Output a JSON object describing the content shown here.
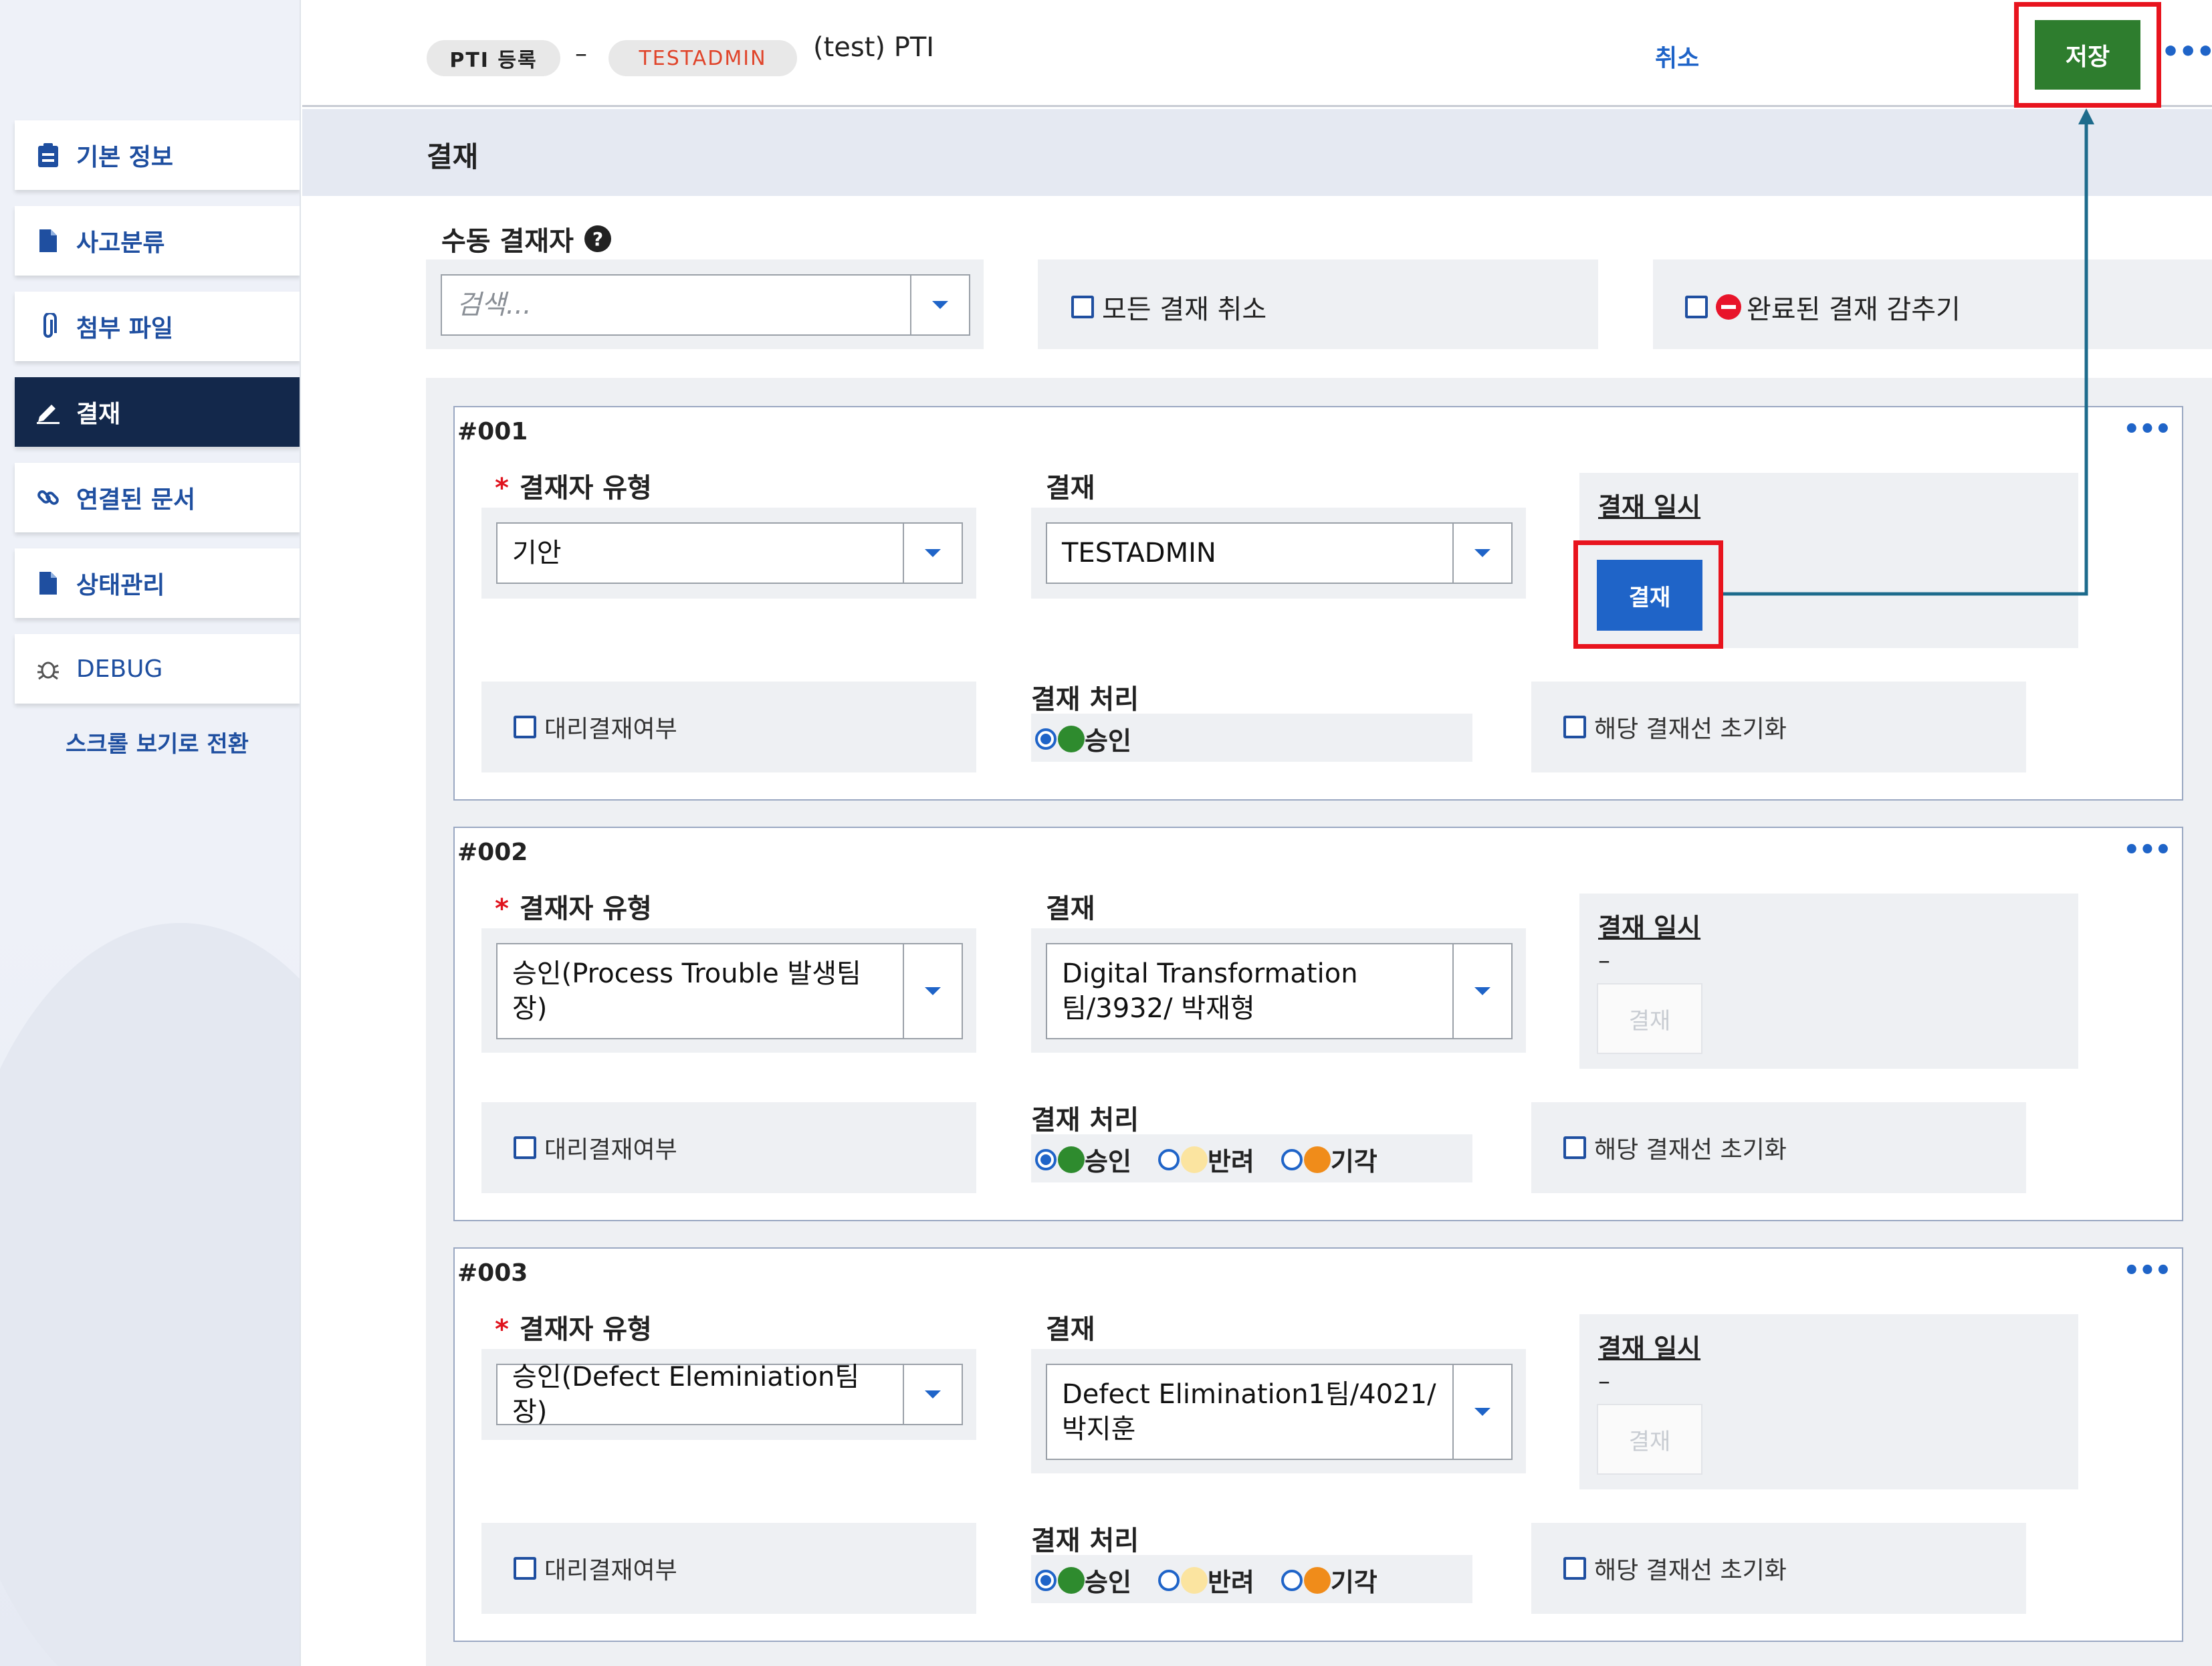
{
  "sidebar": {
    "items": [
      {
        "label": "기본 정보",
        "icon": "clipboard-icon"
      },
      {
        "label": "사고분류",
        "icon": "document-icon"
      },
      {
        "label": "첨부 파일",
        "icon": "paperclip-icon"
      },
      {
        "label": "결재",
        "icon": "pen-icon"
      },
      {
        "label": "연결된 문서",
        "icon": "link-icon"
      },
      {
        "label": "상태관리",
        "icon": "document-icon"
      },
      {
        "label": "DEBUG",
        "icon": "bug-icon"
      }
    ],
    "scroll_link": "스크롤 보기로 전환"
  },
  "header": {
    "tag_pti": "PTI 등록",
    "dash": "–",
    "tag_user": "TESTADMIN",
    "title": "(test) PTI",
    "cancel_label": "취소",
    "save_label": "저장",
    "more_label": "•••"
  },
  "section": {
    "title": "결재"
  },
  "manual": {
    "label": "수동 결재자",
    "search_placeholder": "검색...",
    "cancel_all": "모든 결재 취소",
    "hide_done": "완료된 결재 감추기"
  },
  "labels": {
    "approver_type": "결재자 유형",
    "approver": "결재",
    "approval_datetime": "결재 일시",
    "proxy": "대리결재여부",
    "process": "결재 처리",
    "reset_line": "해당 결재선 초기화",
    "approve_button": "결재",
    "required": "*",
    "more": "•••"
  },
  "options": {
    "approve": "승인",
    "reject": "반려",
    "dismiss": "기각"
  },
  "colors": {
    "approve": "#2e8b2e",
    "reject": "#fbe4a0",
    "dismiss": "#f08c1a",
    "accent": "#1f64c8",
    "save": "#2e7d2e",
    "highlight": "#e8141e"
  },
  "cards": [
    {
      "no": "#001",
      "type": "기안",
      "approver": "TESTADMIN",
      "date": ""
    },
    {
      "no": "#002",
      "type": "승인(Process Trouble 발생팀장)",
      "approver": "Digital Transformation팀/3932/ 박재형",
      "date": "–"
    },
    {
      "no": "#003",
      "type": "승인(Defect Eleminiation팀장)",
      "approver": "Defect Elimination1팀/4021/ 박지훈",
      "date": "–"
    }
  ]
}
